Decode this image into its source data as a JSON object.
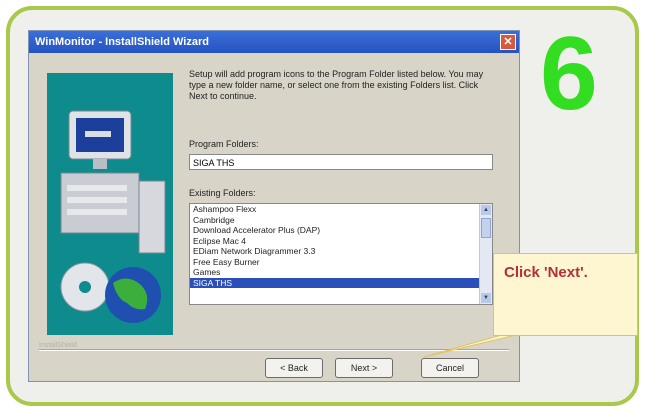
{
  "step_number": "6",
  "dialog": {
    "title": "WinMonitor - InstallShield Wizard",
    "close_label": "✕",
    "description": "Setup will add program icons to the Program Folder listed below. You may type a new folder name, or select one from the existing Folders list. Click Next to continue.",
    "program_folder_label": "Program Folders:",
    "program_folder_value": "SIGA THS",
    "existing_folders_label": "Existing Folders:",
    "existing_folders": [
      "Ashampoo Flexx",
      "Cambridge",
      "Download Accelerator Plus (DAP)",
      "Eclipse Mac 4",
      "EDiam Network Diagrammer 3.3",
      "Free Easy Burner",
      "Games",
      "SIGA THS"
    ],
    "selected_folder_index": 7,
    "brand_text": "InstallShield",
    "buttons": {
      "back": "< Back",
      "next": "Next >",
      "cancel": "Cancel"
    }
  },
  "callout": {
    "text": "Click 'Next'."
  },
  "colors": {
    "step_number": "#33dd22",
    "frame_border": "#a8c94a",
    "titlebar": "#2a5cc8",
    "callout_text": "#b3303a"
  },
  "icons": [
    "computer-illustration",
    "cd-disc-icon",
    "globe-icon",
    "scroll-up-icon",
    "scroll-down-icon",
    "close-icon"
  ]
}
